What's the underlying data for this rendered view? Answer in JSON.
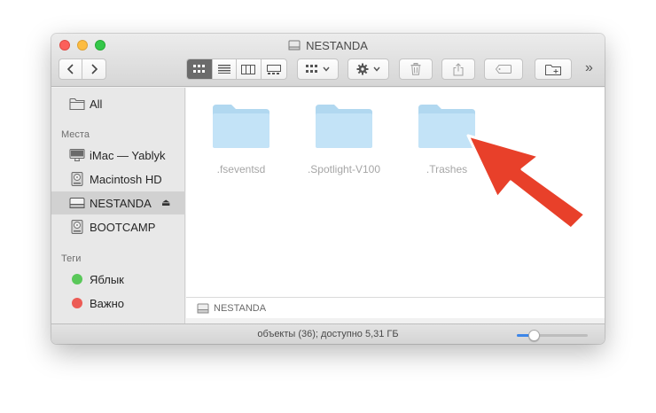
{
  "window": {
    "title": "NESTANDA"
  },
  "toolbar": {
    "more_label": "»",
    "icons": [
      "back-icon",
      "forward-icon",
      "icon-view-icon",
      "list-view-icon",
      "column-view-icon",
      "gallery-view-icon",
      "group-icon",
      "gear-icon",
      "trash-icon",
      "share-icon",
      "tag-icon",
      "new-folder-icon"
    ]
  },
  "sidebar": {
    "all_label": "All",
    "places_header": "Места",
    "places": [
      {
        "label": "iMac — Yablyk",
        "icon": "imac-icon"
      },
      {
        "label": "Macintosh HD",
        "icon": "hard-drive-icon"
      },
      {
        "label": "NESTANDA",
        "icon": "external-drive-icon",
        "selected": true
      },
      {
        "label": "BOOTCAMP",
        "icon": "hard-drive-icon"
      }
    ],
    "tags_header": "Теги",
    "tags": [
      {
        "label": "Яблык",
        "color": "#5ac85a"
      },
      {
        "label": "Важно",
        "color": "#ec5b55"
      }
    ]
  },
  "content": {
    "items": [
      {
        "name": ".fseventsd"
      },
      {
        "name": ".Spotlight-V100"
      },
      {
        "name": ".Trashes"
      }
    ],
    "folder_color": "#c3e3f7"
  },
  "pathbar": {
    "label": "NESTANDA"
  },
  "statusbar": {
    "text": "объекты (36); доступно 5,31 ГБ",
    "zoom_fraction": 0.24
  },
  "annotation": {
    "arrow_color": "#e8402a"
  }
}
